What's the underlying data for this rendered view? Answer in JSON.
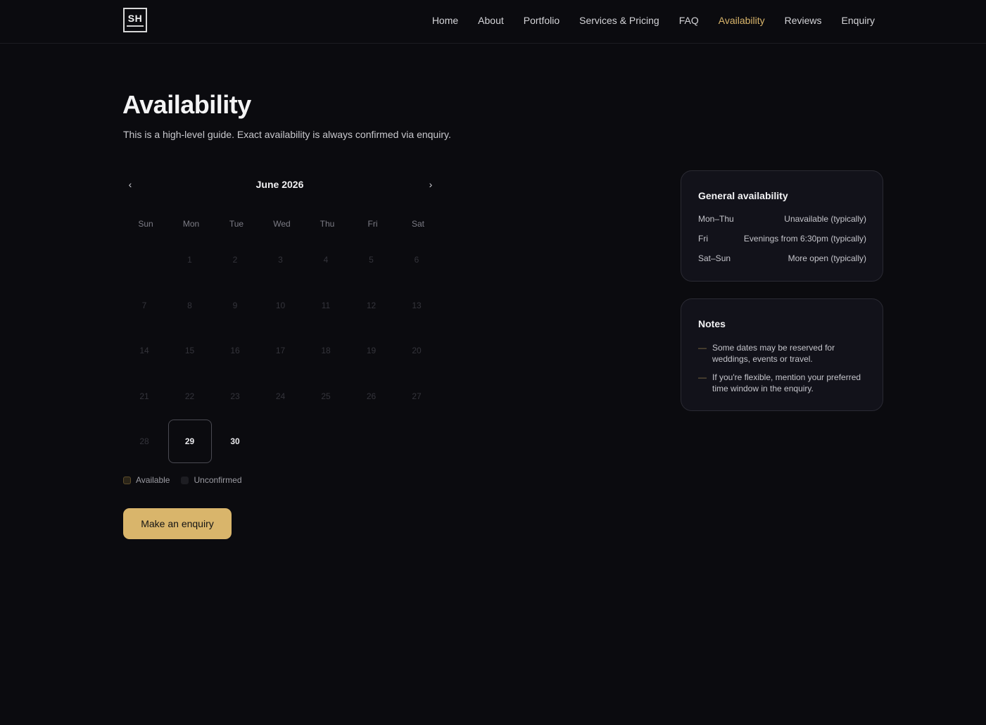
{
  "brand": {
    "logo_text": "SH"
  },
  "nav": {
    "items": [
      {
        "label": "Home"
      },
      {
        "label": "About"
      },
      {
        "label": "Portfolio"
      },
      {
        "label": "Services & Pricing"
      },
      {
        "label": "FAQ"
      },
      {
        "label": "Availability",
        "active": true
      },
      {
        "label": "Reviews"
      },
      {
        "label": "Enquiry"
      }
    ]
  },
  "header": {
    "title": "Availability",
    "subtitle": "This is a high-level guide. Exact availability is always confirmed via enquiry."
  },
  "calendar": {
    "month_label": "June 2026",
    "prev_icon": "‹",
    "next_icon": "›",
    "weekdays": [
      "Sun",
      "Mon",
      "Tue",
      "Wed",
      "Thu",
      "Fri",
      "Sat"
    ],
    "first_weekday_index": 1,
    "days_in_month": 30,
    "today": 29,
    "upcoming": [
      30
    ]
  },
  "legend": {
    "available_label": "Available",
    "unconfirmed_label": "Unconfirmed"
  },
  "cta": {
    "label": "Make an enquiry"
  },
  "general": {
    "title": "General availability",
    "rows": [
      {
        "day": "Mon–Thu",
        "status": "Unavailable (typically)"
      },
      {
        "day": "Fri",
        "status": "Evenings from 6:30pm (typically)"
      },
      {
        "day": "Sat–Sun",
        "status": "More open (typically)"
      }
    ]
  },
  "notes": {
    "title": "Notes",
    "bullet": "—",
    "items": [
      {
        "text": "Some dates may be reserved for weddings, events or travel."
      },
      {
        "text": "If you're flexible, mention your preferred time window in the enquiry."
      }
    ]
  },
  "colors": {
    "accent": "#d9b56b",
    "background": "#0b0b0f",
    "card": "#12121a"
  }
}
